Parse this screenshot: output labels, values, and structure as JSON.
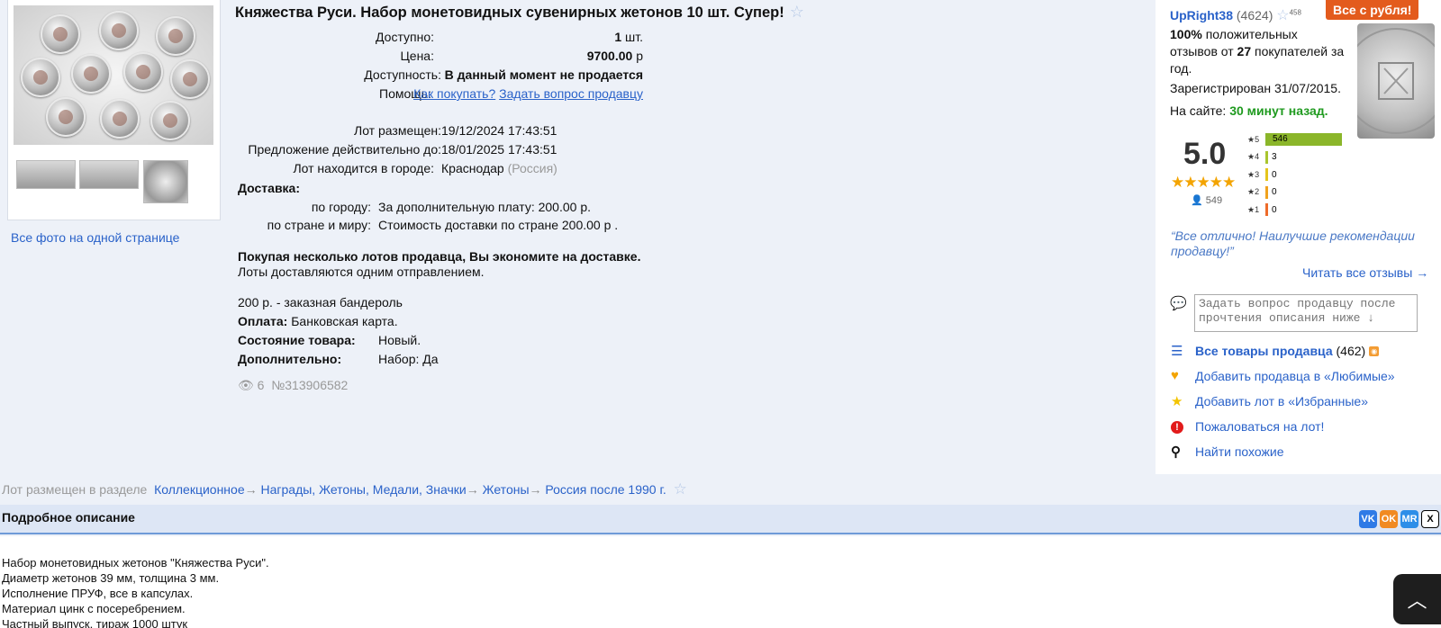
{
  "lot": {
    "title": "Княжества Руси. Набор монетовидных сувенирных жетонов 10 шт. Супер!",
    "available_label": "Доступно:",
    "available_value": "1",
    "available_unit": "шт.",
    "price_label": "Цена:",
    "price_value": "9700.00",
    "price_unit": "р",
    "availability_label": "Доступность:",
    "availability_value": "В данный момент не продается",
    "help_label": "Помощь:",
    "help_link1": "Как покупать?",
    "help_link2": "Задать вопрос продавцу",
    "placed_label": "Лот размещен:",
    "placed_value": "19/12/2024 17:43:51",
    "valid_label": "Предложение действительно до:",
    "valid_value": "18/01/2025 17:43:51",
    "city_label": "Лот находится в городе:",
    "city_value": "Краснодар",
    "city_country": "(Россия)",
    "delivery_label": "Доставка:",
    "delivery_city_label": "по городу:",
    "delivery_city_value": "За дополнительную плату: 200.00 р.",
    "delivery_world_label": "по стране и миру:",
    "delivery_world_value": "Стоимость доставки по стране 200.00 р .",
    "save_note_bold": "Покупая несколько лотов продавца, Вы экономите на доставке.",
    "save_note": "Лоты доставляются одним отправлением.",
    "parcel_note": "200 р. - заказная бандероль",
    "payment_label": "Оплата:",
    "payment_value": "Банковская карта.",
    "condition_label": "Состояние товара:",
    "condition_value": "Новый.",
    "extra_label": "Дополнительно:",
    "extra_value": "Набор: Да",
    "views": "6",
    "lot_number": "№313906582"
  },
  "gallery": {
    "all_photos_link": "Все фото на одной странице"
  },
  "seller": {
    "promo_badge": "Все с рубля!",
    "name": "UpRight38",
    "feedback_count": "(4624)",
    "fav_count": "458",
    "positive_pct": "100%",
    "positive_text1": "положительных",
    "positive_text2": "отзывов от",
    "buyers_count": "27",
    "positive_text3": "покупателей за",
    "positive_text4": "год.",
    "registered": "Зарегистрирован 31/07/2015.",
    "online_label": "На сайте:",
    "online_value": "30 минут назад.",
    "rating": "5.0",
    "stars": "★★★★★",
    "reviewers": "549",
    "bars": [
      {
        "label": "★5",
        "count": "546",
        "fraction": 1.0,
        "color": "#8bb62a"
      },
      {
        "label": "★4",
        "count": "3",
        "fraction": 0.006,
        "color": "#a9c52e"
      },
      {
        "label": "★3",
        "count": "0",
        "fraction": 0.0,
        "color": "#e5c51c"
      },
      {
        "label": "★2",
        "count": "0",
        "fraction": 0.0,
        "color": "#f0a21d"
      },
      {
        "label": "★1",
        "count": "0",
        "fraction": 0.0,
        "color": "#ee6b2a"
      }
    ],
    "quote": "“Все отлично! Наилучшие рекомендации продавцу!”",
    "read_all": "Читать все отзывы →",
    "ask_placeholder": "Задать вопрос продавцу после прочтения описания ниже ↓",
    "all_goods_label": "Все товары продавца",
    "all_goods_count": "(462)",
    "add_fav_seller": "Добавить продавца в «Любимые»",
    "add_fav_lot": "Добавить лот в «Избранные»",
    "complain": "Пожаловаться на лот!",
    "find_similar": "Найти похожие"
  },
  "breadcrumbs": {
    "prefix": "Лот размещен в разделе",
    "items": [
      "Коллекционное",
      "Награды, Жетоны, Медали, Значки",
      "Жетоны",
      "Россия после 1990 г."
    ],
    "separator": "→"
  },
  "description": {
    "header": "Подробное описание",
    "lines": [
      "Набор монетовидных жетонов \"Княжества Руси\".",
      "Диаметр жетонов 39 мм, толщина 3 мм.",
      "Исполнение ПРУФ, все в капсулах.",
      "Материал цинк с посеребрением.",
      "Частный выпуск, тираж 1000 штук"
    ]
  },
  "share": [
    "VK",
    "OK",
    "MR",
    "X"
  ],
  "icons": {
    "fav_star": "star-outline-icon",
    "to_top": "chevron-up-icon"
  }
}
